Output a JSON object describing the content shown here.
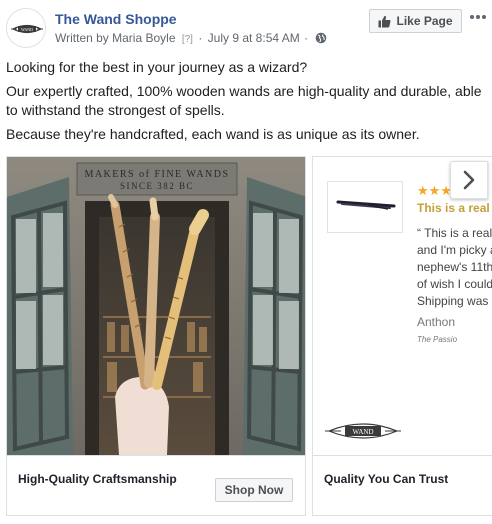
{
  "header": {
    "page_name": "The Wand Shoppe",
    "written_by": "Written by Maria Boyle",
    "help_mark": "[?]",
    "separator": "·",
    "timestamp": "July 9 at 8:54 AM",
    "separator2": "·",
    "audience_icon": "globe-icon",
    "like_button": "Like Page",
    "like_icon": "thumbs-up-icon",
    "more_icon": "more-options-icon"
  },
  "post": {
    "paragraphs": [
      "Looking for the best in your journey as a wizard?",
      "Our expertly crafted, 100% wooden wands are high-quality and durable, able to withstand the strongest of spells.",
      "Because they're handcrafted, each wand is as unique as its owner."
    ]
  },
  "carousel": {
    "cards": [
      {
        "image_sign": "MAKERS of FINE WANDS\nSINCE 382 BC",
        "title": "High-Quality Craftsmanship",
        "cta": "Shop Now"
      },
      {
        "stars": "★★★★★",
        "headline": "This is a real r",
        "body_lines": [
          "“ This is a real",
          "and I'm picky a",
          "nephew's 11th",
          "of wish I could",
          "Shipping was s"
        ],
        "author": "Anthon",
        "author_sub": "The Passio",
        "logo_text": "WAND",
        "title": "Quality You Can Trust"
      }
    ],
    "next_icon": "chevron-right-icon"
  },
  "colors": {
    "link_blue": "#365899",
    "meta_gray": "#616770",
    "star_gold": "#f5a623",
    "headline_gold": "#c4a03a",
    "border": "#dddfe2"
  }
}
